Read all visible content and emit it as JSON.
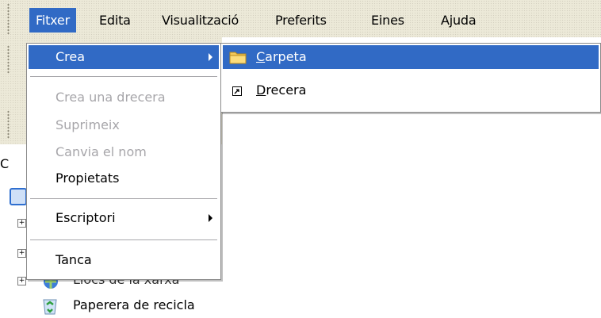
{
  "menubar": {
    "items": [
      {
        "label": "Fitxer"
      },
      {
        "label": "Edita"
      },
      {
        "label": "Visualització"
      },
      {
        "label": "Preferits"
      },
      {
        "label": "Eines"
      },
      {
        "label": "Ajuda"
      }
    ],
    "active_color": "#316ac5"
  },
  "file_menu": {
    "items": [
      {
        "label": "Crea",
        "state": "highlighted",
        "has_submenu": true
      },
      {
        "label": "Crea una drecera",
        "state": "disabled"
      },
      {
        "label": "Suprimeix",
        "state": "disabled"
      },
      {
        "label": "Canvia el nom",
        "state": "disabled"
      },
      {
        "label": "Propietats",
        "state": "enabled"
      },
      {
        "label": "Escriptori",
        "state": "enabled",
        "has_submenu": true
      },
      {
        "label": "Tanca",
        "state": "enabled"
      }
    ]
  },
  "new_submenu": {
    "items": [
      {
        "label_first": "C",
        "label_rest": "arpeta",
        "icon": "folder-icon",
        "state": "highlighted"
      },
      {
        "label_first": "D",
        "label_rest": "recera",
        "icon": "shortcut-icon",
        "state": "enabled"
      }
    ]
  },
  "tree": {
    "partial_letter": "C",
    "items": [
      {
        "label": "Llocs de la xarxa",
        "icon": "network-places-icon"
      },
      {
        "label": "Paperera de recicla",
        "icon": "recycle-bin-icon"
      }
    ]
  }
}
